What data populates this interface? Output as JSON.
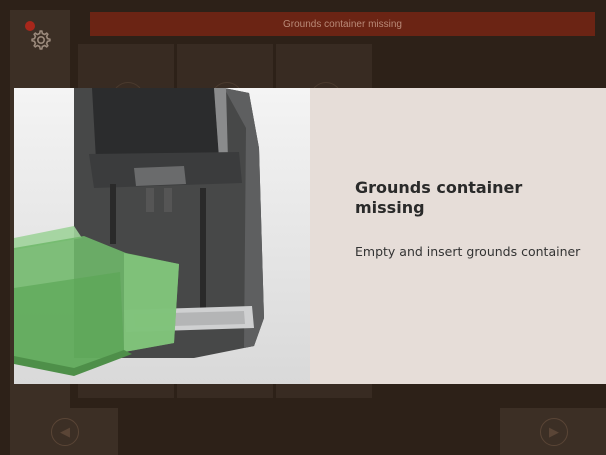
{
  "status_bar": {
    "text": "Grounds container missing"
  },
  "sidebar": {
    "settings_icon": "gear-icon",
    "alert_indicator": "alert-dot"
  },
  "dialog": {
    "title": "Grounds container missing",
    "message": "Empty and insert grounds container",
    "illustration": "coffee-machine-grounds-container"
  },
  "nav": {
    "back_icon": "back-icon",
    "forward_icon": "forward-icon"
  },
  "colors": {
    "background": "#2d2118",
    "status_bar": "#6b2414",
    "dialog_panel": "#e6ddd8",
    "highlight_green": "#6fb86a"
  }
}
